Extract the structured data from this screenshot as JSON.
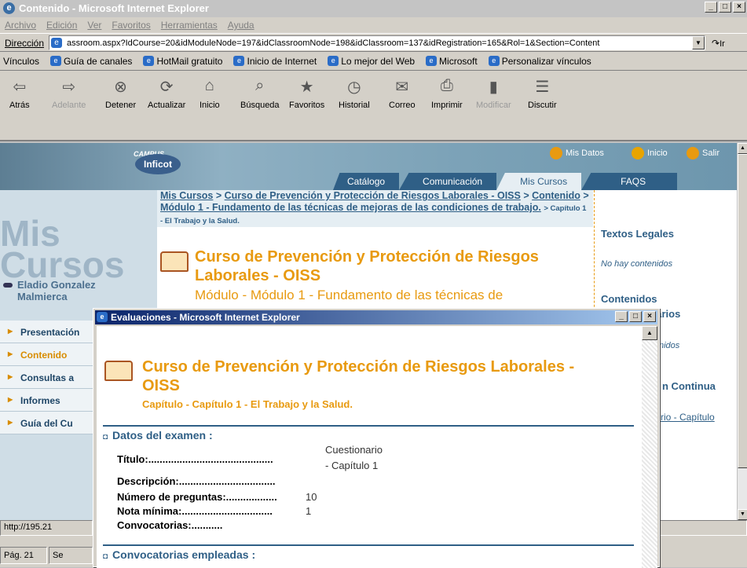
{
  "window": {
    "title": "Contenido - Microsoft Internet Explorer"
  },
  "menubar": [
    "Archivo",
    "Edición",
    "Ver",
    "Favoritos",
    "Herramientas",
    "Ayuda"
  ],
  "address": {
    "label": "Dirección",
    "url": "assroom.aspx?IdCourse=20&idModuleNode=197&idClassroomNode=198&idClassroom=137&idRegistration=165&Rol=1&Section=Content",
    "go": "Ir"
  },
  "links": {
    "label": "Vínculos",
    "items": [
      "Guía de canales",
      "HotMail gratuito",
      "Inicio de Internet",
      "Lo mejor del Web",
      "Microsoft",
      "Personalizar vínculos"
    ]
  },
  "toolbar": [
    {
      "label": "Atrás",
      "icon": "back-icon",
      "enabled": true
    },
    {
      "label": "Adelante",
      "icon": "forward-icon",
      "enabled": false
    },
    {
      "label": "Detener",
      "icon": "stop-icon",
      "enabled": true
    },
    {
      "label": "Actualizar",
      "icon": "refresh-icon",
      "enabled": true
    },
    {
      "label": "Inicio",
      "icon": "home-icon",
      "enabled": true
    },
    {
      "label": "Búsqueda",
      "icon": "search-icon",
      "enabled": true
    },
    {
      "label": "Favoritos",
      "icon": "favorites-icon",
      "enabled": true
    },
    {
      "label": "Historial",
      "icon": "history-icon",
      "enabled": true
    },
    {
      "label": "Correo",
      "icon": "mail-icon",
      "enabled": true
    },
    {
      "label": "Imprimir",
      "icon": "print-icon",
      "enabled": true
    },
    {
      "label": "Modificar",
      "icon": "edit-icon",
      "enabled": false
    },
    {
      "label": "Discutir",
      "icon": "discuss-icon",
      "enabled": true
    }
  ],
  "site": {
    "campus": "CAMPUS",
    "logo": "Inficot",
    "topnav": [
      "Mis Datos",
      "Inicio",
      "Salir"
    ],
    "tabs": [
      "Catálogo",
      "Comunicación",
      "Mis Cursos",
      "FAQS"
    ],
    "active_tab": "Mis Cursos",
    "breadcrumb": {
      "mis_cursos": "Mis Cursos",
      "sep": " > ",
      "curso": "Curso de Prevención y Protección de Riesgos Laborales - OISS",
      "contenido": "Contenido",
      "modulo": "Módulo 1 - Fundamento de las técnicas de mejoras de las condiciones de trabajo.",
      "capitulo": "> Capítulo 1 - El Trabajo y la Salud."
    },
    "mis_cursos_graphic_line1": "Mis",
    "mis_cursos_graphic_line2": "Cursos",
    "user_name_line1": "Eladio Gonzalez",
    "user_name_line2": "Malmierca",
    "menu": [
      "Presentación",
      "Contenido",
      "Consultas a",
      "Informes",
      "Guía del Cu"
    ],
    "course_title": "Curso de Prevención y Protección de Riesgos Laborales - OISS",
    "module_line": "Módulo - Módulo 1 - Fundamento de las técnicas de",
    "right": {
      "legal_heading": "Textos Legales",
      "legal_empty": "No hay contenidos",
      "contenidos_heading": "Contenidos",
      "comentarios_fragment": "ntarios",
      "comentarios_empty_fragment": "nidos",
      "evaluacion_fragment": "n Continua",
      "evaluacion_link_fragment": "rio - Capítulo"
    }
  },
  "status": {
    "url": "http://195.21",
    "page": "Pág. 21",
    "sec": "Se"
  },
  "popup": {
    "title": "Evaluaciones - Microsoft Internet Explorer",
    "course_title": "Curso de Prevención y Protección de Riesgos Laborales - OISS",
    "chapter": "Capítulo - Capítulo 1 - El Trabajo y la Salud.",
    "section1": "Datos del examen :",
    "fields": {
      "titulo_label": "Título:............................................",
      "titulo_value_1": "Cuestionario",
      "titulo_value_2": "- Capítulo 1",
      "descripcion_label": "Descripción:..................................",
      "preguntas_label": "Número de preguntas:..................",
      "preguntas_value": "10",
      "nota_label": "Nota mínima:................................",
      "nota_value": "1",
      "convocatorias_label": "Convocatorias:..........."
    },
    "section2": "Convocatorias empleadas :"
  }
}
